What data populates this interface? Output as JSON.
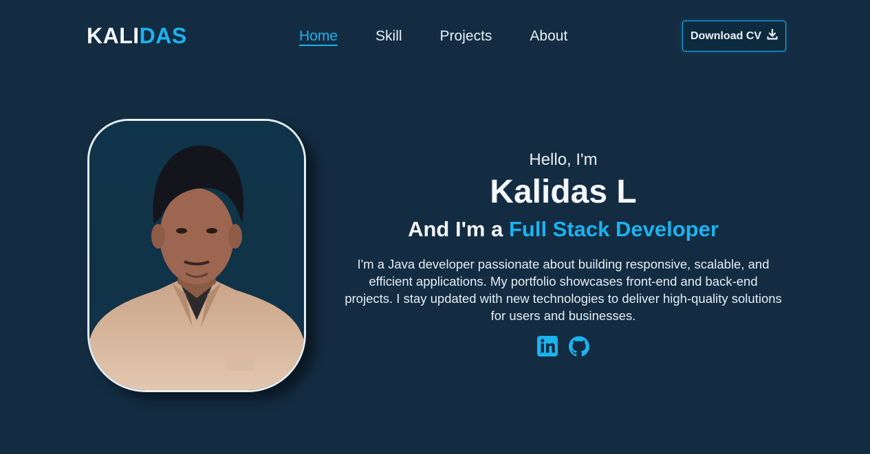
{
  "logo": {
    "part1": "KALI",
    "part2": "DAS"
  },
  "nav": {
    "items": [
      {
        "label": "Home",
        "active": true
      },
      {
        "label": "Skill",
        "active": false
      },
      {
        "label": "Projects",
        "active": false
      },
      {
        "label": "About",
        "active": false
      }
    ]
  },
  "cv_button": {
    "label": "Download CV",
    "icon": "download-icon"
  },
  "hero": {
    "greeting": "Hello, I'm",
    "name": "Kalidas L",
    "role_prefix": "And I'm a ",
    "role_highlight": "Full Stack Developer",
    "bio": "I'm a Java developer passionate about building responsive, scalable, and efficient applications. My portfolio showcases front-end and back-end projects. I stay updated with new technologies to deliver high-quality solutions for users and businesses."
  },
  "social": [
    {
      "name": "linkedin-icon"
    },
    {
      "name": "github-icon"
    }
  ],
  "colors": {
    "background": "#132c42",
    "accent": "#1bb3ef",
    "text": "#eaf2f8"
  }
}
